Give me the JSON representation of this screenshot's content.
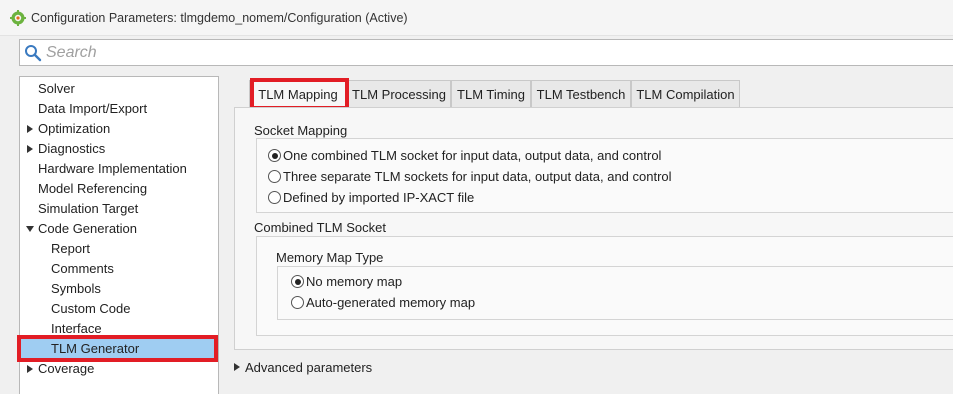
{
  "window": {
    "title": "Configuration Parameters: tlmgdemo_nomem/Configuration (Active)",
    "app_icon": "gear-icon"
  },
  "search": {
    "placeholder": "Search"
  },
  "tree": {
    "items": [
      {
        "label": "Solver",
        "expander": "none",
        "level": 0
      },
      {
        "label": "Data Import/Export",
        "expander": "none",
        "level": 0
      },
      {
        "label": "Optimization",
        "expander": "collapsed",
        "level": 0
      },
      {
        "label": "Diagnostics",
        "expander": "collapsed",
        "level": 0
      },
      {
        "label": "Hardware Implementation",
        "expander": "none",
        "level": 0
      },
      {
        "label": "Model Referencing",
        "expander": "none",
        "level": 0
      },
      {
        "label": "Simulation Target",
        "expander": "none",
        "level": 0
      },
      {
        "label": "Code Generation",
        "expander": "expanded",
        "level": 0
      },
      {
        "label": "Report",
        "expander": "none",
        "level": 1
      },
      {
        "label": "Comments",
        "expander": "none",
        "level": 1
      },
      {
        "label": "Symbols",
        "expander": "none",
        "level": 1
      },
      {
        "label": "Custom Code",
        "expander": "none",
        "level": 1
      },
      {
        "label": "Interface",
        "expander": "none",
        "level": 1
      },
      {
        "label": "TLM Generator",
        "expander": "none",
        "level": 1,
        "selected": true
      },
      {
        "label": "Coverage",
        "expander": "collapsed",
        "level": 0
      }
    ]
  },
  "tabs": [
    {
      "label": "TLM Mapping",
      "active": true
    },
    {
      "label": "TLM Processing",
      "active": false
    },
    {
      "label": "TLM Timing",
      "active": false
    },
    {
      "label": "TLM Testbench",
      "active": false
    },
    {
      "label": "TLM Compilation",
      "active": false
    }
  ],
  "socket_mapping": {
    "heading": "Socket Mapping",
    "options": [
      {
        "label": "One combined TLM socket for input data, output data, and control",
        "checked": true
      },
      {
        "label": "Three separate TLM sockets for input data, output data, and control",
        "checked": false
      },
      {
        "label": "Defined by imported IP-XACT file",
        "checked": false
      }
    ]
  },
  "combined_socket": {
    "heading": "Combined TLM Socket",
    "memory_map": {
      "heading": "Memory Map Type",
      "options": [
        {
          "label": "No memory map",
          "checked": true
        },
        {
          "label": "Auto-generated memory map",
          "checked": false
        }
      ]
    }
  },
  "advanced": {
    "label": "Advanced parameters"
  },
  "colors": {
    "highlight": "#e21d25",
    "selection": "#9fcdf2"
  }
}
